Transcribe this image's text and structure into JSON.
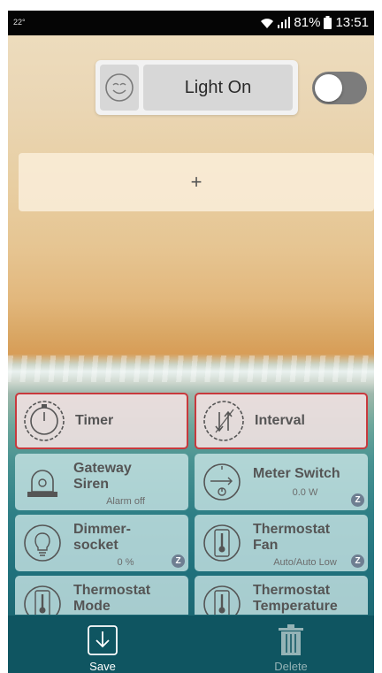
{
  "status_bar": {
    "temperature": "22°",
    "battery": "81%",
    "time": "13:51"
  },
  "scene": {
    "icon": "smiley-icon",
    "name": "Light On",
    "toggle_state": "off"
  },
  "add_button": {
    "label": "+"
  },
  "tiles": [
    {
      "name": "Timer",
      "subtitle": "",
      "icon": "timer-icon",
      "selected": true,
      "zwave": false
    },
    {
      "name": "Interval",
      "subtitle": "",
      "icon": "interval-icon",
      "selected": true,
      "zwave": false
    },
    {
      "name": "Gateway Siren",
      "subtitle": "Alarm off",
      "icon": "siren-icon",
      "selected": false,
      "zwave": false
    },
    {
      "name": "Meter Switch",
      "subtitle": "0.0 W",
      "icon": "meter-icon",
      "selected": false,
      "zwave": true
    },
    {
      "name": "Dimmer-socket",
      "subtitle": "0 %",
      "icon": "bulb-icon",
      "selected": false,
      "zwave": true
    },
    {
      "name": "Thermostat Fan",
      "subtitle": "Auto/Auto Low",
      "icon": "thermostat-icon",
      "selected": false,
      "zwave": true
    },
    {
      "name": "Thermostat Mode",
      "subtitle": "",
      "icon": "thermostat-icon",
      "selected": false,
      "zwave": false
    },
    {
      "name": "Thermostat Temperature",
      "subtitle": "",
      "icon": "thermostat-icon",
      "selected": false,
      "zwave": false
    }
  ],
  "tile_labels": {
    "timer": "Timer",
    "interval": "Interval",
    "gateway_siren_1": "Gateway",
    "gateway_siren_2": "Siren",
    "gateway_siren_sub": "Alarm off",
    "meter_switch": "Meter Switch",
    "meter_switch_sub": "0.0 W",
    "dimmer_1": "Dimmer-",
    "dimmer_2": "socket",
    "dimmer_sub": "0 %",
    "thermo_fan_1": "Thermostat",
    "thermo_fan_2": "Fan",
    "thermo_fan_sub": "Auto/Auto Low",
    "thermo_mode_1": "Thermostat",
    "thermo_mode_2": "Mode",
    "thermo_temp_1": "Thermostat",
    "thermo_temp_2": "Temperature",
    "zwave_badge": "Z"
  },
  "bottom_bar": {
    "save_label": "Save",
    "delete_label": "Delete"
  },
  "colors": {
    "selected_border": "#c8393d",
    "bottom_bar": "#0f5561",
    "zwave_badge": "#6e7e91"
  }
}
